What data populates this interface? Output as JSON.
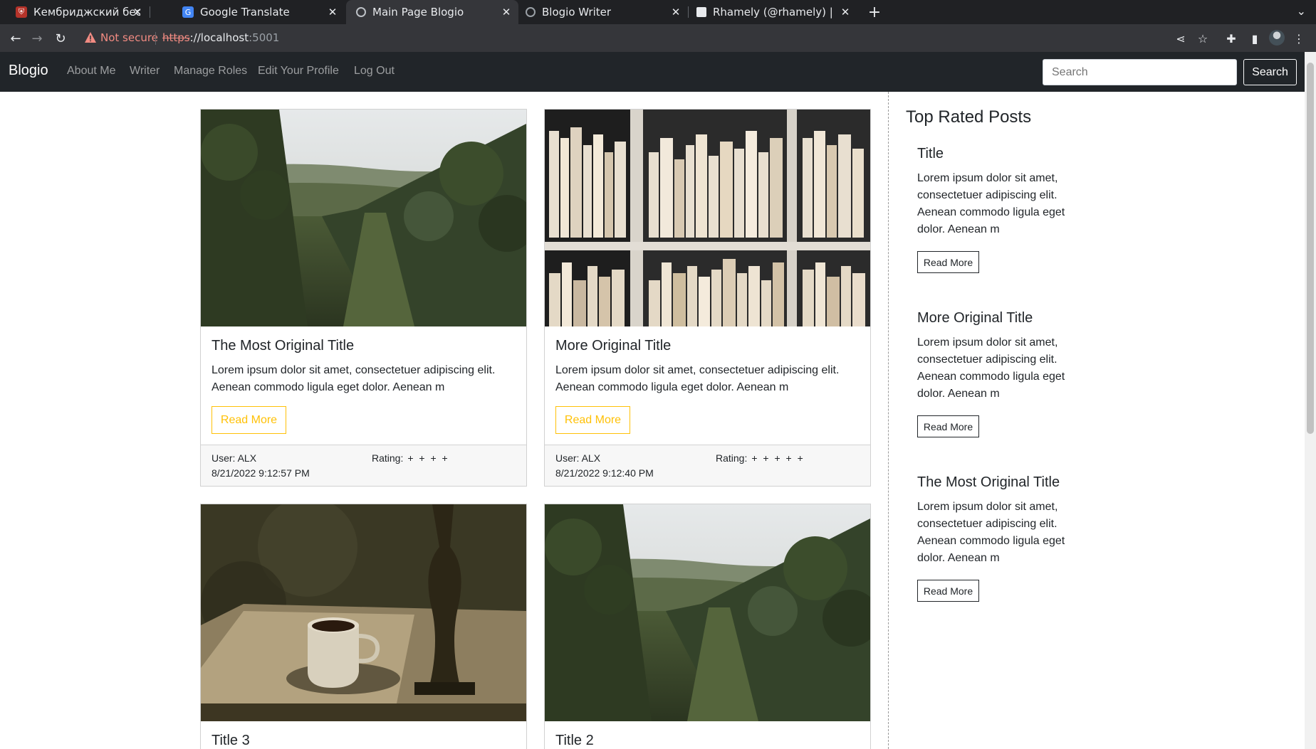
{
  "browser": {
    "tabs": [
      {
        "title": "Кембриджский бесплатн",
        "favicon": "cambridge-icon",
        "active": false
      },
      {
        "title": "Google Translate",
        "favicon": "google-translate-icon",
        "active": false
      },
      {
        "title": "Main Page Blogio",
        "favicon": "globe-icon",
        "active": true
      },
      {
        "title": "Blogio Writer",
        "favicon": "globe-icon",
        "active": false
      },
      {
        "title": "Rhamely (@rhamely) | Uns",
        "favicon": "unsplash-icon",
        "active": false
      }
    ],
    "security_label": "Not secure",
    "url_scheme": "https",
    "url_host": "://localhost",
    "url_port": ":5001"
  },
  "site": {
    "brand": "Blogio",
    "nav_links": [
      "About Me",
      "Writer",
      "Manage Roles",
      "Edit Your Profile",
      "Log Out"
    ],
    "search_placeholder": "Search",
    "search_button": "Search"
  },
  "posts": [
    {
      "title": "The Most Original Title",
      "excerpt": "Lorem ipsum dolor sit amet, consectetuer adipiscing elit. Aenean commodo ligula eget dolor. Aenean m",
      "read_more": "Read More",
      "user": "User: ALX",
      "date": "8/21/2022 9:12:57 PM",
      "rating_label": "Rating:",
      "stars": "+ + + +",
      "image": "vineyard"
    },
    {
      "title": "More Original Title",
      "excerpt": "Lorem ipsum dolor sit amet, consectetuer adipiscing elit. Aenean commodo ligula eget dolor. Aenean m",
      "read_more": "Read More",
      "user": "User: ALX",
      "date": "8/21/2022 9:12:40 PM",
      "rating_label": "Rating:",
      "stars": "+ + + + +",
      "image": "bookshelf"
    },
    {
      "title": "Title 3",
      "image": "teacup"
    },
    {
      "title": "Title 2",
      "image": "vineyard"
    }
  ],
  "sidebar": {
    "heading": "Top Rated Posts",
    "posts": [
      {
        "title": "Title",
        "excerpt": "Lorem ipsum dolor sit amet, consectetuer adipiscing elit. Aenean commodo ligula eget dolor. Aenean m",
        "read_more": "Read More"
      },
      {
        "title": "More Original Title",
        "excerpt": "Lorem ipsum dolor sit amet, consectetuer adipiscing elit. Aenean commodo ligula eget dolor. Aenean m",
        "read_more": "Read More"
      },
      {
        "title": "The Most Original Title",
        "excerpt": "Lorem ipsum dolor sit amet, consectetuer adipiscing elit. Aenean commodo ligula eget dolor. Aenean m",
        "read_more": "Read More"
      }
    ]
  },
  "colors": {
    "navbar_bg": "#212529",
    "accent_yellow": "#ffc107",
    "chrome_bg": "#35363a"
  }
}
